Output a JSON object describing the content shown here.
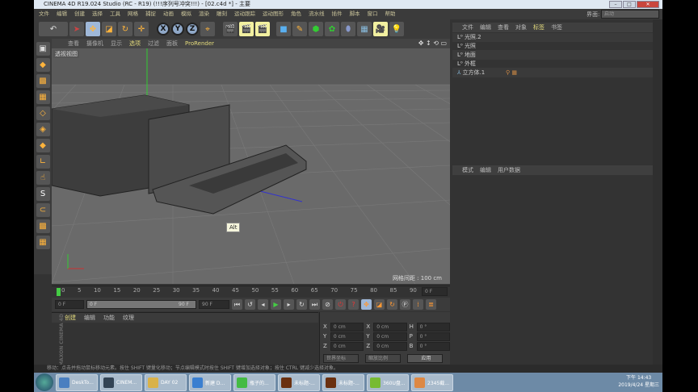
{
  "title": "CINEMA 4D R19.024 Studio (RC - R19) (!!!序列号冲突!!!) - [02.c4d *] - 主要",
  "window_buttons": [
    "–",
    "□",
    "✕"
  ],
  "menu": [
    "文件",
    "编辑",
    "创建",
    "选择",
    "工具",
    "网格",
    "捕捉",
    "动画",
    "模拟",
    "渲染",
    "雕刻",
    "运动跟踪",
    "运动图形",
    "角色",
    "流水线",
    "插件",
    "脚本",
    "窗口",
    "帮助"
  ],
  "layout": {
    "label": "界面:",
    "value": "启动"
  },
  "axes": [
    "X",
    "Y",
    "Z"
  ],
  "viewport": {
    "menu": [
      "查看",
      "摄像机",
      "显示",
      "选项",
      "过滤",
      "面板",
      "ProRender"
    ],
    "name": "透视视图",
    "grid_spacing": "网格间距 : 100 cm",
    "tooltip": "Alt"
  },
  "object_manager": {
    "menu": [
      "文件",
      "编辑",
      "查看",
      "对象",
      "标签",
      "书签"
    ],
    "objects": [
      "光照.2",
      "光照",
      "地面",
      "外框",
      "立方体.1"
    ]
  },
  "attributes": {
    "menu": [
      "模式",
      "编辑",
      "用户数据"
    ]
  },
  "timeline": {
    "ticks": [
      "0",
      "5",
      "10",
      "15",
      "20",
      "25",
      "30",
      "35",
      "40",
      "45",
      "50",
      "55",
      "60",
      "65",
      "70",
      "75",
      "80",
      "85",
      "90"
    ],
    "current": "0 F",
    "start": "0 F",
    "range_start": "0 F",
    "range_end": "90 F",
    "end": "90 F"
  },
  "material": {
    "menu": [
      "创建",
      "编辑",
      "功能",
      "纹理"
    ]
  },
  "coords": {
    "rows": [
      [
        "X",
        "0 cm",
        "X",
        "0 cm",
        "H",
        "0 °"
      ],
      [
        "Y",
        "0 cm",
        "Y",
        "0 cm",
        "P",
        "0 °"
      ],
      [
        "Z",
        "0 cm",
        "Z",
        "0 cm",
        "B",
        "0 °"
      ]
    ],
    "mode1": "世界坐标",
    "mode2": "缩放比例",
    "apply": "应用"
  },
  "status": "移动：点击并拖动鼠标移动元素。按住 SHIFT 键量化移动；节点编辑模式时按住 SHIFT 键增加选择对象；按住 CTRL 键减少选择对象。",
  "taskbar": {
    "items": [
      "DeskTo...",
      "CINEM...",
      "DAY 02",
      "新建 D...",
      "瓶子的...",
      "未标题-...",
      "未标题-...",
      "360U盘...",
      "2345截..."
    ],
    "time": "下午 14:43",
    "date": "2019/4/24 星期三"
  },
  "brand": "MAXON CINEMA 4D"
}
